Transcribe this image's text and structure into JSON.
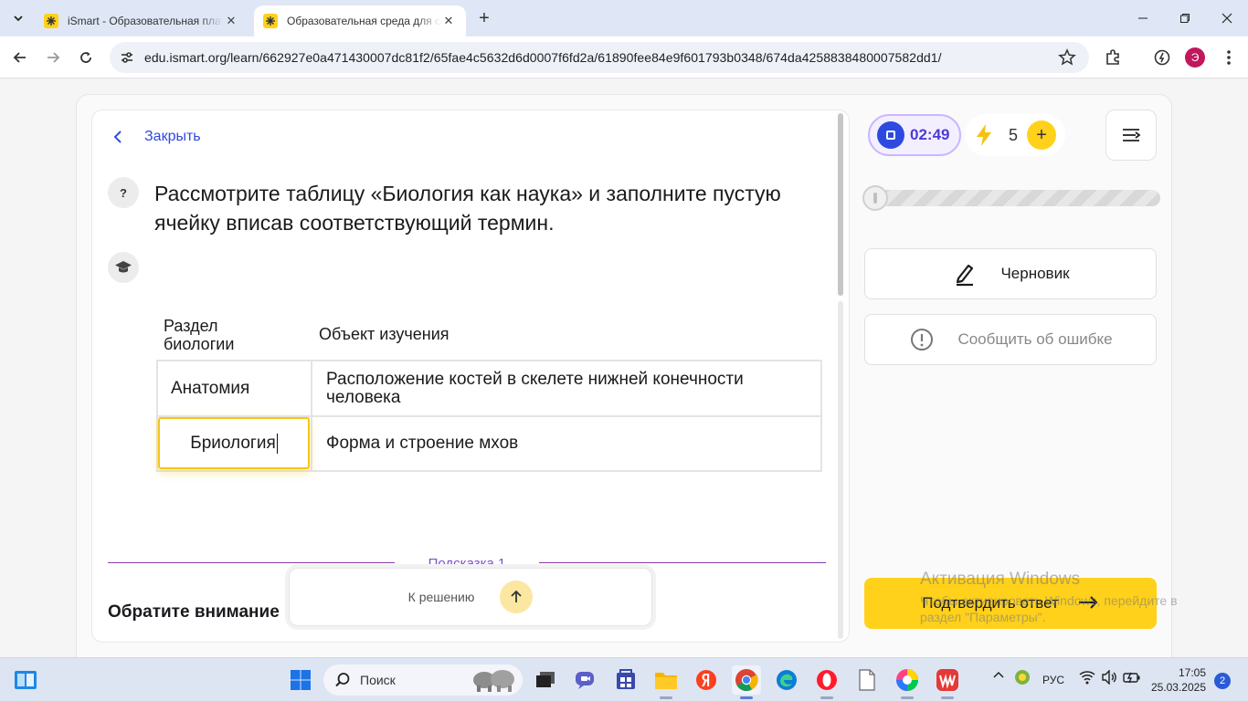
{
  "browser": {
    "tabs": [
      {
        "title": "iSmart - Образовательная платформа",
        "active": false
      },
      {
        "title": "Образовательная среда для саморазвития",
        "active": true
      }
    ],
    "url": "edu.ismart.org/learn/662927e0a471430007dc81f2/65fae4c5632d6d0007f6fd2a/61890fee84e9f601793b0348/674da4258838480007582dd1/",
    "profile_initial": "Э"
  },
  "lesson": {
    "close_label": "Закрыть",
    "question_badge": "?",
    "question": "Рассмотрите таблицу «Биология как наука» и заполните пустую ячейку вписав соответствующий термин.",
    "table": {
      "headers": [
        "Раздел биологии",
        "Объект изучения"
      ],
      "rows": [
        {
          "section": "Анатомия",
          "object": "Расположение костей в скелете нижней конечности человека"
        },
        {
          "section": "Бриология",
          "object": "Форма и строение мхов"
        }
      ]
    },
    "hint_label": "Подсказка 1",
    "hint_text": "Обратите внимание",
    "to_solution_label": "К решению"
  },
  "sidebar": {
    "timer": "02:49",
    "energy": "5",
    "progress_fraction": 0,
    "draft_label": "Черновик",
    "report_label": "Сообщить об ошибке",
    "submit_label": "Подтвердить ответ"
  },
  "watermark": {
    "title": "Активация Windows",
    "subtitle": "Чтобы активировать Windows, перейдите в раздел \"Параметры\"."
  },
  "taskbar": {
    "search_label": "Поиск",
    "language": "РУС",
    "time": "17:05",
    "date": "25.03.2025",
    "notifications": "2"
  },
  "colors": {
    "accent_blue": "#2d4ae0",
    "brand_yellow": "#ffd11a",
    "timer_purple": "#4a3bd6",
    "hint_purple": "#7b4fd0"
  }
}
